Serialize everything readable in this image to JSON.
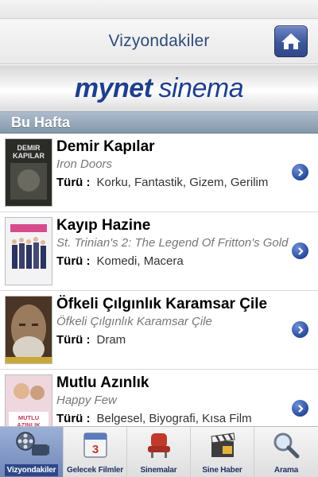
{
  "header": {
    "title": "Vizyondakiler"
  },
  "brand": {
    "part1": "mynet",
    "part2": "sinema"
  },
  "section": {
    "title": "Bu Hafta"
  },
  "genre_label": "Türü :",
  "movies": [
    {
      "title": "Demir Kapılar",
      "original": "Iron Doors",
      "genres": "Korku, Fantastik, Gizem, Gerilim",
      "poster_text": "DEMIR KAPILAR",
      "poster_colors": [
        "#3a3a36",
        "#111111"
      ]
    },
    {
      "title": "Kayıp Hazine",
      "original": "St. Trinian's 2: The Legend Of Fritton's Gold",
      "genres": "Komedi, Macera",
      "poster_text": "",
      "poster_colors": [
        "#f2f2f4",
        "#d9d2e2"
      ]
    },
    {
      "title": "Öfkeli Çılgınlık Karamsar Çile",
      "original": "Öfkeli Çılgınlık Karamsar Çile",
      "genres": "Dram",
      "poster_text": "",
      "poster_colors": [
        "#8a6a4c",
        "#3b2a1e"
      ]
    },
    {
      "title": "Mutlu Azınlık",
      "original": "Happy Few",
      "genres": "Belgesel, Biyografi, Kısa Film",
      "poster_text": "MUTLU AZINLIK",
      "poster_colors": [
        "#e7c8d2",
        "#b8838f"
      ]
    }
  ],
  "tabs": [
    {
      "label": "Vizyondakiler",
      "icon": "film-reel-icon",
      "active": true
    },
    {
      "label": "Gelecek Filmler",
      "icon": "calendar-icon",
      "active": false
    },
    {
      "label": "Sinemalar",
      "icon": "cinema-seat-icon",
      "active": false
    },
    {
      "label": "Sine Haber",
      "icon": "clapperboard-icon",
      "active": false
    },
    {
      "label": "Arama",
      "icon": "magnifier-icon",
      "active": false
    }
  ],
  "colors": {
    "accent": "#2d4787",
    "section": "#8598ac",
    "chevron": "#274a9b"
  }
}
